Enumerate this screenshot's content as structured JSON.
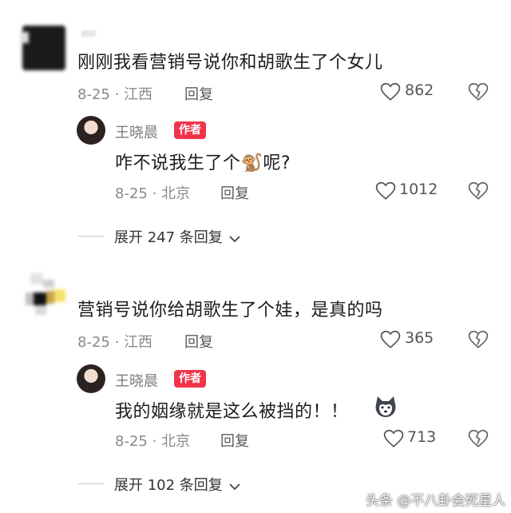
{
  "threads": [
    {
      "comment": {
        "text": "刚刚我看营销号说你和胡歌生了个女儿",
        "date_location": "8-25 · 江西",
        "reply_label": "回复",
        "likes": "862"
      },
      "author_reply": {
        "username": "王晓晨",
        "badge": "作者",
        "text_before": "咋不说我生了个",
        "emoji": "🐒",
        "text_after": "呢?",
        "date_location": "8-25 · 北京",
        "reply_label": "回复",
        "likes": "1012"
      },
      "expand_label": "展开 247 条回复"
    },
    {
      "comment": {
        "text": "营销号说你给胡歌生了个娃，是真的吗",
        "date_location": "8-25 · 江西",
        "reply_label": "回复",
        "likes": "365"
      },
      "author_reply": {
        "username": "王晓晨",
        "badge": "作者",
        "text_before": "我的姻缘就是这么被挡的！！",
        "emoji": "",
        "text_after": "",
        "date_location": "8-25 · 北京",
        "reply_label": "回复",
        "likes": "713"
      },
      "expand_label": "展开 102 条回复"
    }
  ],
  "watermark": {
    "text": "头条 @不八卦会死星人"
  },
  "colors": {
    "badge": "#f0354b",
    "meta": "#8a8a8a"
  },
  "icons": {
    "like": "heart-outline-icon",
    "dislike": "broken-heart-icon",
    "expand": "chevron-down-icon",
    "husky": "husky-emoji-icon"
  }
}
